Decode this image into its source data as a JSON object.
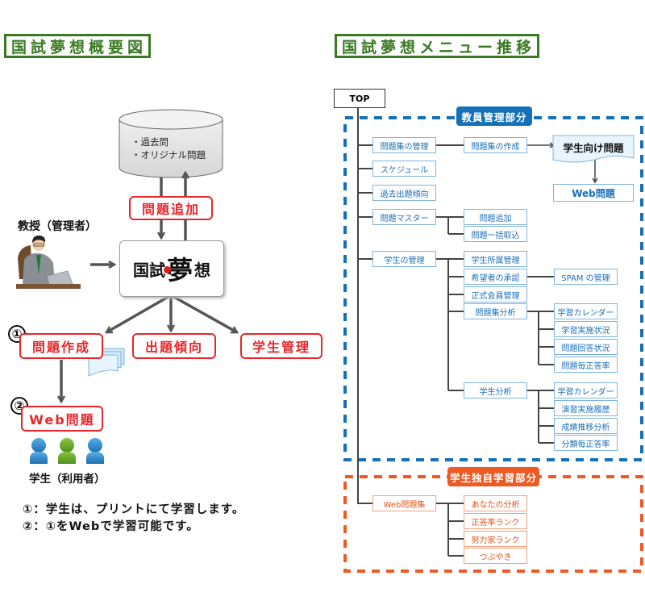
{
  "left_panel": {
    "title": "国試夢想概要図",
    "database": {
      "items": [
        "・過去問",
        "・オリジナル問題"
      ]
    },
    "add_questions_label": "問題追加",
    "professor_label": "教授（管理者）",
    "logo": {
      "part1": "国試",
      "part2": "夢",
      "part3": "想"
    },
    "functions": [
      {
        "label": "問題作成",
        "marker": "①"
      },
      {
        "label": "出題傾向"
      },
      {
        "label": "学生管理"
      }
    ],
    "web_questions": {
      "label": "Web問題",
      "marker": "②"
    },
    "students_label": "学生（利用者）",
    "notes": [
      "①：学生は、プリントにて学習します。",
      "②：①をWebで学習可能です。"
    ]
  },
  "right_panel": {
    "title": "国試夢想メニュー推移",
    "top_label": "TOP",
    "teacher_section": {
      "label": "教員管理部分",
      "color": "#1470b8",
      "items": [
        {
          "label": "問題集の管理",
          "children": [
            {
              "label": "問題集の作成"
            }
          ]
        },
        {
          "label": "スケジュール"
        },
        {
          "label": "過去出題傾向"
        },
        {
          "label": "問題マスター",
          "children": [
            {
              "label": "問題追加"
            },
            {
              "label": "問題一括取込"
            }
          ]
        },
        {
          "label": "学生の管理",
          "children": [
            {
              "label": "学生所属管理"
            },
            {
              "label": "希望者の承認",
              "children": [
                {
                  "label": "SPAM の管理"
                }
              ]
            },
            {
              "label": "正式会員管理"
            },
            {
              "label": "問題集分析",
              "children": [
                {
                  "label": "学習カレンダー"
                },
                {
                  "label": "学習実施状況"
                },
                {
                  "label": "問題回答状況"
                },
                {
                  "label": "問題毎正答率"
                }
              ]
            },
            {
              "label": "学生分析",
              "children": [
                {
                  "label": "学習カレンダー"
                },
                {
                  "label": "演習実施履歴"
                },
                {
                  "label": "成績推移分析"
                },
                {
                  "label": "分類毎正答率"
                }
              ]
            }
          ]
        }
      ],
      "output_doc": "学生向け問題",
      "output_web": "Web問題"
    },
    "student_section": {
      "label": "学生独自学習部分",
      "color": "#ee5a24",
      "items": [
        {
          "label": "Web問題集",
          "children": [
            {
              "label": "あなたの分析"
            },
            {
              "label": "正答率ランク"
            },
            {
              "label": "努力家ランク"
            },
            {
              "label": "つぶやき"
            }
          ]
        }
      ]
    }
  },
  "colors": {
    "title_green": "#3a7a22",
    "accent_red": "#e8262a",
    "teacher_blue": "#1470b8",
    "student_orange": "#ee5a24"
  }
}
